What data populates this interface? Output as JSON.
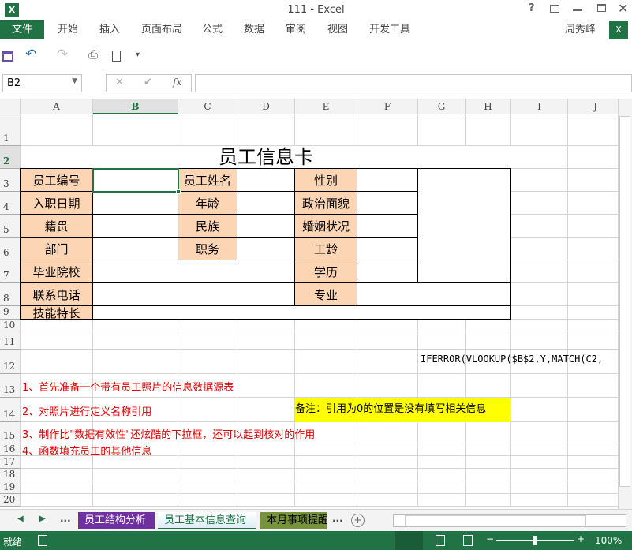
{
  "window": {
    "title": "111  -  Excel",
    "help": "?",
    "user": "周秀峰"
  },
  "ribbon": {
    "tabs": [
      "文件",
      "开始",
      "插入",
      "页面布局",
      "公式",
      "数据",
      "审阅",
      "视图",
      "开发工具"
    ]
  },
  "formula_bar": {
    "name_box": "B2",
    "formula": "",
    "fx": "fx",
    "cancel": "✕",
    "enter": "✔"
  },
  "columns": [
    "A",
    "B",
    "C",
    "D",
    "E",
    "F",
    "G",
    "H",
    "I",
    "J"
  ],
  "rows": [
    "1",
    "2",
    "3",
    "4",
    "5",
    "6",
    "7",
    "8",
    "9",
    "10",
    "11",
    "12",
    "13",
    "14",
    "15",
    "16",
    "17",
    "18",
    "19",
    "20"
  ],
  "sheet": {
    "title": "员工信息卡",
    "labels": {
      "A2": "员工编号",
      "C2": "员工姓名",
      "E2": "性别",
      "A3": "入职日期",
      "C3": "年龄",
      "E3": "政治面貌",
      "A4": "籍贯",
      "C4": "民族",
      "E4": "婚姻状况",
      "A5": "部门",
      "C5": "职务",
      "E5": "工龄",
      "A6": "毕业院校",
      "E6": "学历",
      "A7": "联系电话",
      "E7": "专业",
      "A8": "技能特长"
    },
    "formula_text": "IFERROR(VLOOKUP($B$2,Y,MATCH(C2,",
    "notes": [
      "1、首先准备一个带有员工照片的信息数据源表",
      "2、对照片进行定义名称引用",
      "3、制作比\"数据有效性\"还炫酷的下拉框，还可以起到核对的作用",
      "4、函数填充员工的其他信息"
    ],
    "remark": "备注：引用为0的位置是没有填写相关信息"
  },
  "sheet_tabs": [
    {
      "label": "员工结构分析",
      "color": "#7030a0"
    },
    {
      "label": "员工基本信息查询",
      "color": "#dbeef3"
    },
    {
      "label": "本月事项提醒",
      "color": "#77933c"
    }
  ],
  "sheet_more": "...",
  "status": {
    "ready": "就绪",
    "zoom": "100%"
  }
}
